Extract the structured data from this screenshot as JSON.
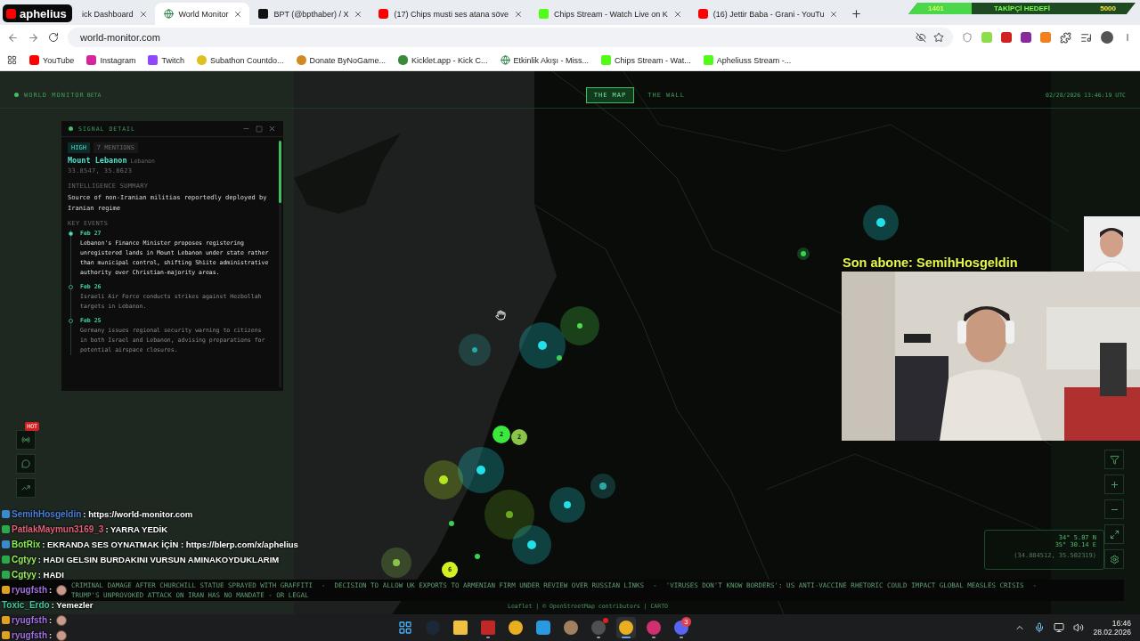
{
  "overlay_logo": {
    "text": "aphelius"
  },
  "follower_goal": {
    "current": "1401",
    "label": "TAKİPÇİ HEDEFİ",
    "target": "5000",
    "level": 0.28
  },
  "tabs": [
    {
      "title": "ick Dashboard",
      "selected": false
    },
    {
      "title": "World Monitor",
      "selected": true
    },
    {
      "title": "BPT (@bpthaber) / X",
      "selected": false
    },
    {
      "title": "(17) Chips musti ses atana söve",
      "selected": false
    },
    {
      "title": "Chips Stream - Watch Live on K",
      "selected": false
    },
    {
      "title": "(16) Jettir Baba - Grani - YouTu",
      "selected": false
    }
  ],
  "address_bar": {
    "url": "world-monitor.com"
  },
  "bookmarks": [
    "YouTube",
    "Instagram",
    "Twitch",
    "Subathon Countdo...",
    "Donate ByNoGame...",
    "Kicklet.app - Kick C...",
    "Etkinlik Akışı - Miss...",
    "Chips Stream - Wat...",
    "Apheliuss Stream -..."
  ],
  "app": {
    "brand": {
      "name": "WORLD MONITOR",
      "badge": "BETA"
    },
    "view_tabs": [
      {
        "label": "THE MAP",
        "selected": true
      },
      {
        "label": "THE WALL",
        "selected": false
      }
    ],
    "timestamp": "02/28/2026 13:46:19 UTC",
    "signal_panel": {
      "title": "SIGNAL DETAIL",
      "severity": "HIGH",
      "mentions": "7 MENTIONS",
      "location": "Mount Lebanon",
      "country": "Lebanon",
      "coords": "33.8547, 35.8623",
      "summary_heading": "INTELLIGENCE SUMMARY",
      "summary": "Source of non-Iranian militias reportedly deployed by Iranian regime",
      "events_heading": "KEY EVENTS",
      "events": [
        {
          "date": "Feb 27",
          "text": "Lebanon's Finance Minister proposes registering unregistered lands in Mount Lebanon under state rather than municipal control, shifting Shiite administrative authority over Christian-majority areas.",
          "selected": true
        },
        {
          "date": "Feb 26",
          "text": "Israeli Air Force conducts strikes against Hezbollah targets in Lebanon.",
          "selected": false
        },
        {
          "date": "Feb 25",
          "text": "Germany issues regional security warning to citizens in both Israel and Lebanon, advising preparations for potential airspace closures.",
          "selected": false
        }
      ]
    },
    "side_tools": [
      {
        "kind": "signal",
        "badge": "HOT"
      },
      {
        "kind": "chat"
      },
      {
        "kind": "chart"
      }
    ],
    "markers": [
      {
        "color": "#22e0e8"
      },
      {
        "color": "#39d353"
      },
      {
        "color": "#2aa8a8"
      },
      {
        "color": "#22e0e8"
      },
      {
        "color": "#4ade4a"
      },
      {
        "color": "#39d353"
      },
      {
        "color": "#3be83b",
        "count": "2"
      },
      {
        "color": "#8bc34a",
        "count": "2"
      },
      {
        "color": "#b5e61d"
      },
      {
        "color": "#22e0e8"
      },
      {
        "color": "#6aa820"
      },
      {
        "color": "#22e0e8"
      },
      {
        "color": "#2aa8a8"
      },
      {
        "color": "#22e0e8"
      },
      {
        "color": "#d4f020",
        "count": "6"
      },
      {
        "color": "#39d353"
      },
      {
        "color": "#39d353"
      },
      {
        "color": "#8bc34a"
      }
    ],
    "map_controls": [
      {
        "kind": "filter"
      },
      {
        "kind": "zoom-in"
      },
      {
        "kind": "zoom-out"
      },
      {
        "kind": "fullscreen"
      },
      {
        "kind": "settings"
      }
    ],
    "coordinates": {
      "lat": "34° 5.07 N",
      "lon": "35° 30.14 E",
      "decimal": "(34.884512, 35.502319)"
    },
    "ticker": [
      "CRIMINAL DAMAGE AFTER CHURCHILL STATUE SPRAYED WITH GRAFFITI",
      "DECISION TO ALLOW UK EXPORTS TO ARMENIAN FIRM UNDER REVIEW OVER RUSSIAN LINKS",
      "'VIRUSES DON'T KNOW BORDERS': US ANTI-VACCINE RHETORIC COULD IMPACT GLOBAL MEASLES CRISIS",
      "TRUMP'S UNPROVOKED ATTACK ON IRAN HAS NO MANDATE - OR LEGAL"
    ],
    "ticker_separator": "-",
    "attribution": "Leaflet | © OpenStreetMap contributors | CARTO"
  },
  "stream": {
    "latest_sub": "Son abone: SemihHosgeldin",
    "chat": [
      {
        "user": "SemihHosgeldin",
        "color": "#4a7fe0",
        "text": ": https://world-monitor.com",
        "emote": false
      },
      {
        "user": "PatlakMaymun3169_3",
        "color": "#e0607a",
        "text": ": YARRA YEDİK",
        "emote": false
      },
      {
        "user": "BotRix",
        "color": "#8af04a",
        "text": ": EKRANDA SES OYNATMAK İÇİN : https://blerp.com/x/aphelius",
        "emote": false
      },
      {
        "user": "Cgtyy",
        "color": "#9af05a",
        "text": ": HADI GELSIN BURDAKINI VURSUN AMINAKOYDUKLARIM",
        "emote": false
      },
      {
        "user": "Cgtyy",
        "color": "#9af05a",
        "text": ": HADI",
        "emote": false
      },
      {
        "user": "ryugfsth",
        "color": "#a070e0",
        "text": ":",
        "emote": true
      },
      {
        "user": "Toxic_Erdo",
        "color": "#40c8a0",
        "text": ": Yemezler",
        "emote": false
      },
      {
        "user": "ryugfsth",
        "color": "#a070e0",
        "text": ":",
        "emote": true
      },
      {
        "user": "ryugfsth",
        "color": "#a070e0",
        "text": ":",
        "emote": true
      }
    ]
  },
  "taskbar": {
    "apps": [
      {
        "kind": "windows",
        "running": false,
        "selected": false,
        "alert": false
      },
      {
        "kind": "steam",
        "running": false,
        "selected": false,
        "alert": false
      },
      {
        "kind": "files",
        "running": false,
        "selected": false,
        "alert": false
      },
      {
        "kind": "voicemeeter",
        "running": true,
        "selected": false,
        "alert": false
      },
      {
        "kind": "chrome",
        "running": false,
        "selected": false,
        "alert": false
      },
      {
        "kind": "app",
        "running": false,
        "selected": false,
        "alert": false
      },
      {
        "kind": "horse",
        "running": false,
        "selected": false,
        "alert": false
      },
      {
        "kind": "obs",
        "running": true,
        "selected": false,
        "alert": true
      },
      {
        "kind": "chrome",
        "running": true,
        "selected": true,
        "alert": false
      },
      {
        "kind": "maps",
        "running": true,
        "selected": false,
        "alert": false
      },
      {
        "kind": "discord",
        "running": true,
        "selected": false,
        "alert": false,
        "badge": "3"
      }
    ],
    "time": "16:46",
    "date": "28.02.2026"
  }
}
